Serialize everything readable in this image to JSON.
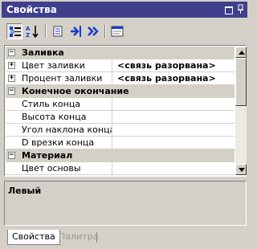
{
  "window": {
    "title": "Свойства"
  },
  "toolbar": {
    "icons": [
      "categorized-icon",
      "alphabetical-icon",
      "property-pages-icon",
      "expand-icon",
      "collapse-icon",
      "description-icon"
    ]
  },
  "grid": {
    "rows": [
      {
        "type": "category",
        "label": "Заливка",
        "expander": "−"
      },
      {
        "type": "prop",
        "name": "Цвет заливки",
        "value": "<связь разорвана>",
        "expander": "+"
      },
      {
        "type": "prop",
        "name": "Процент заливки",
        "value": "<связь разорвана>",
        "expander": "+"
      },
      {
        "type": "category",
        "label": "Конечное окончание",
        "expander": "−"
      },
      {
        "type": "prop",
        "name": "Стиль конца",
        "value": ""
      },
      {
        "type": "prop",
        "name": "Высота конца",
        "value": ""
      },
      {
        "type": "prop",
        "name": "Угол наклона конца",
        "value": ""
      },
      {
        "type": "prop",
        "name": "D врезки конца",
        "value": ""
      },
      {
        "type": "category",
        "label": "Материал",
        "expander": "−"
      },
      {
        "type": "prop",
        "name": "Цвет основы",
        "value": ""
      }
    ]
  },
  "description": {
    "title": "Левый"
  },
  "tabs": [
    {
      "label": "Свойства",
      "active": true
    },
    {
      "label": "Палитра",
      "active": false
    }
  ],
  "colors": {
    "title_bar": "#3f3f8e",
    "panel": "#d4d0c8",
    "accent_blue": "#1a3cc8"
  }
}
